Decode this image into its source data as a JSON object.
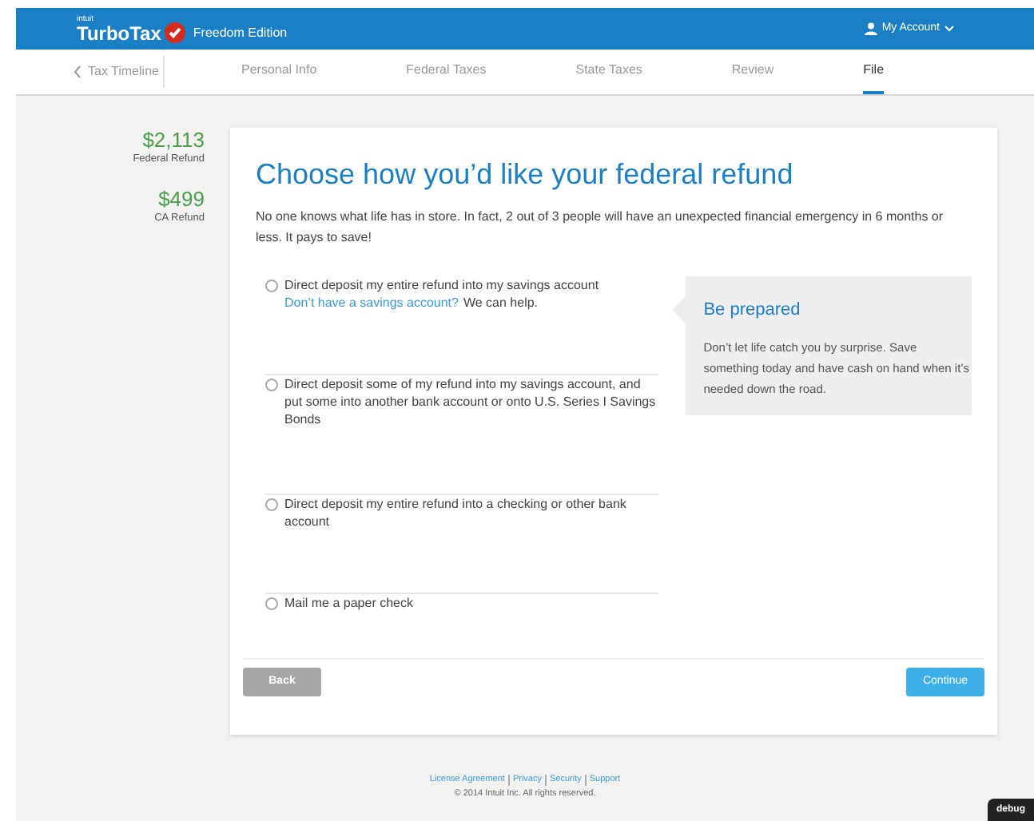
{
  "header": {
    "brand_small": "intuit",
    "brand": "TurboTax",
    "edition": "Freedom Edition",
    "account": "My Account"
  },
  "nav": {
    "back": "Tax Timeline",
    "tabs": [
      {
        "label": "Personal Info",
        "selected": false
      },
      {
        "label": "Federal Taxes",
        "selected": false
      },
      {
        "label": "State Taxes",
        "selected": false
      },
      {
        "label": "Review",
        "selected": false
      },
      {
        "label": "File",
        "selected": true
      }
    ]
  },
  "refunds": [
    {
      "amount": "$2,113",
      "label": "Federal Refund"
    },
    {
      "amount": "$499",
      "label": "CA Refund"
    }
  ],
  "title": "Choose how you’d like your federal refund",
  "intro": "No one knows what life has in store. In fact, 2 out of 3 people will have an unexpected financial emergency in 6 months or less. It pays to save!",
  "options": [
    {
      "label": "Direct deposit my entire refund into my savings account",
      "link": "Don’t have a savings account?",
      "link_suffix": "We can help.",
      "selected": false
    },
    {
      "label": "Direct deposit some of my refund into my savings account, and put some into another bank account or onto U.S. Series I Savings Bonds",
      "selected": false
    },
    {
      "label": "Direct deposit my entire refund into a checking or other bank account",
      "selected": false
    },
    {
      "label": "Mail me a paper check",
      "selected": false
    }
  ],
  "aside": {
    "title": "Be prepared",
    "text": "Don’t let life catch you by surprise. Save something today and have cash on hand when it’s needed down the road."
  },
  "buttons": {
    "back": "Back",
    "continue": "Continue"
  },
  "footer": {
    "links": [
      "License Agreement",
      "Privacy",
      "Security",
      "Support"
    ],
    "copyright": "© 2014 Intuit Inc. All rights reserved."
  },
  "debug": "debug"
}
